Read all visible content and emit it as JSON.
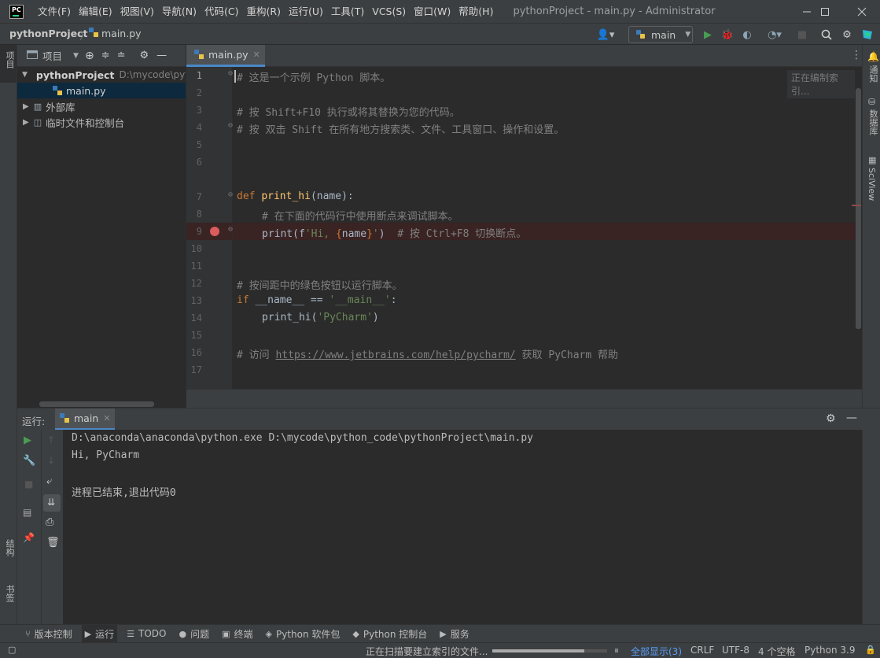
{
  "app": {
    "logo_text": "PC",
    "window_title": "pythonProject - main.py - Administrator",
    "menu": [
      "文件(F)",
      "编辑(E)",
      "视图(V)",
      "导航(N)",
      "代码(C)",
      "重构(R)",
      "运行(U)",
      "工具(T)",
      "VCS(S)",
      "窗口(W)",
      "帮助(H)"
    ]
  },
  "navbar": {
    "project": "pythonProject",
    "file": "main.py",
    "run_config": "main"
  },
  "left_strip": {
    "project_tab": "项目",
    "structure_tab": "结构",
    "bookmarks_tab": "书签"
  },
  "right_strip": {
    "notifications_tab": "通知",
    "database_tab": "数据库",
    "sciview_tab": "SciView"
  },
  "project_panel": {
    "title": "项目",
    "root_name": "pythonProject",
    "root_path": "D:\\mycode\\python_code\\pythonProject",
    "file": "main.py",
    "external_libs": "外部库",
    "scratches": "临时文件和控制台"
  },
  "editor": {
    "tab_label": "main.py",
    "indexing_hint": "正在编制索引...",
    "line_numbers": [
      "1",
      "2",
      "3",
      "4",
      "5",
      "6",
      "7",
      "8",
      "9",
      "10",
      "11",
      "12",
      "13",
      "14",
      "15",
      "16",
      "17"
    ],
    "lines": {
      "l1": "# 这是一个示例 Python 脚本。",
      "l3": "# 按 Shift+F10 执行或将其替换为您的代码。",
      "l4": "# 按 双击 Shift 在所有地方搜索类、文件、工具窗口、操作和设置。",
      "l7_kw": "def",
      "l7_fn": "print_hi",
      "l7_rest": "(name):",
      "l8": "# 在下面的代码行中使用断点来调试脚本。",
      "l9_a": "print(f",
      "l9_str1": "'Hi, ",
      "l9_br1": "{",
      "l9_name": "name",
      "l9_br2": "}",
      "l9_str2": "'",
      "l9_b": ")",
      "l9_com": "# 按 Ctrl+F8 切换断点。",
      "l12": "# 按间距中的绿色按钮以运行脚本。",
      "l13_kw": "if",
      "l13_rest": " __name__ == ",
      "l13_str": "'__main__'",
      "l13_end": ":",
      "l14_a": "print_hi(",
      "l14_str": "'PyCharm'",
      "l14_b": ")",
      "l16_a": "# 访问 ",
      "l16_url": "https://www.jetbrains.com/help/pycharm/",
      "l16_b": " 获取 PyCharm 帮助"
    }
  },
  "run_panel": {
    "label": "运行:",
    "tab": "main",
    "output": [
      "D:\\anaconda\\anaconda\\python.exe D:\\mycode\\python_code\\pythonProject\\main.py",
      "Hi, PyCharm",
      "",
      "进程已结束,退出代码0"
    ]
  },
  "tool_tabs": [
    "版本控制",
    "运行",
    "TODO",
    "问题",
    "终端",
    "Python 软件包",
    "Python 控制台",
    "服务"
  ],
  "status": {
    "scanning": "正在扫描要建立索引的文件...",
    "show_all": "全部显示(3)",
    "line_sep": "CRLF",
    "encoding": "UTF-8",
    "indent": "4 个空格",
    "interpreter": "Python 3.9",
    "progress": 0.8
  },
  "colors": {
    "accent": "#4a88c7",
    "run_green": "#499c54",
    "breakpoint": "#db5c5c",
    "breakpoint_line": "#3a2323"
  }
}
